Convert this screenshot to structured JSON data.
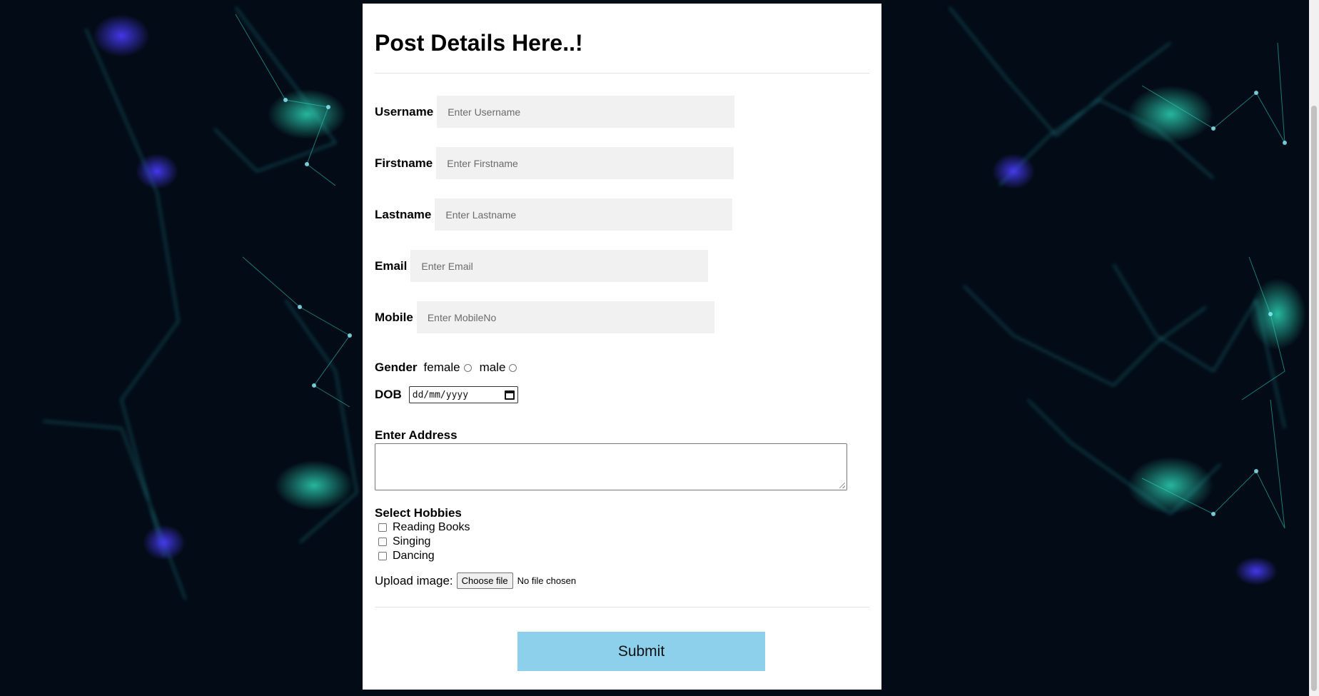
{
  "form": {
    "title": "Post Details Here..!",
    "fields": [
      {
        "label": "Username",
        "placeholder": "Enter Username"
      },
      {
        "label": "Firstname",
        "placeholder": "Enter Firstname"
      },
      {
        "label": "Lastname",
        "placeholder": "Enter Lastname"
      },
      {
        "label": "Email",
        "placeholder": "Enter Email"
      },
      {
        "label": "Mobile",
        "placeholder": "Enter MobileNo"
      }
    ],
    "gender": {
      "label": "Gender",
      "options": [
        "female",
        "male"
      ]
    },
    "dob": {
      "label": "DOB",
      "placeholder": "dd/mm/yyyy"
    },
    "address": {
      "label": "Enter Address"
    },
    "hobbies": {
      "label": "Select Hobbies",
      "options": [
        "Reading Books",
        "Singing",
        "Dancing"
      ]
    },
    "upload": {
      "label": "Upload image:",
      "button": "Choose file",
      "status": "No file chosen"
    },
    "submit_label": "Submit"
  },
  "colors": {
    "background": "#030b16",
    "card": "#ffffff",
    "input_bg": "#f1f1f1",
    "submit_bg": "#8dd0ec",
    "network_teal": "#2fd6c3",
    "network_blue": "#3a3cff"
  }
}
